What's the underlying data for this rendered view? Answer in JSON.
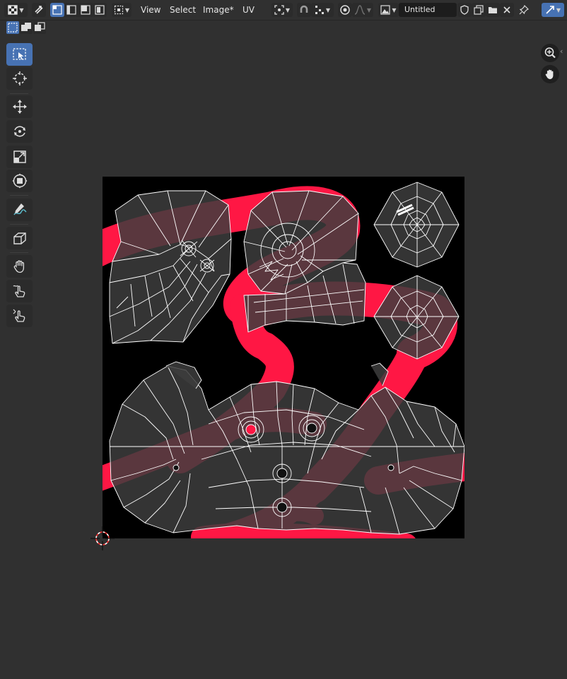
{
  "header": {
    "menus": [
      "View",
      "Select",
      "Image*",
      "UV"
    ],
    "image_name": "Untitled"
  },
  "icons": {
    "editor_type": "uv-editor-icon",
    "sync_selection": "sync-selection-icon",
    "select_modes": [
      "vertex-select-icon",
      "edge-select-icon",
      "face-select-icon",
      "island-select-icon"
    ],
    "sticky_mode": "sticky-select-icon",
    "pivot": "pivot-icon",
    "snap": "magnet-icon",
    "snap_target": "snap-increment-icon",
    "proportional": "proportional-edit-icon",
    "falloff": "falloff-curve-icon",
    "browse_image": "image-browse-icon",
    "fake_user": "shield-icon",
    "new_image": "new-image-icon",
    "open_image": "folder-icon",
    "unlink": "close-icon",
    "pin": "pin-icon",
    "gizmo": "gizmo-icon"
  },
  "tools": [
    {
      "name": "tool-select-box",
      "icon": "select-box-icon",
      "selected": true
    },
    {
      "name": "tool-cursor",
      "icon": "cursor-icon",
      "selected": false
    },
    {
      "name": "tool-move",
      "icon": "move-icon",
      "selected": false
    },
    {
      "name": "tool-rotate",
      "icon": "rotate-icon",
      "selected": false
    },
    {
      "name": "tool-scale",
      "icon": "scale-icon",
      "selected": false
    },
    {
      "name": "tool-transform",
      "icon": "transform-icon",
      "selected": false
    },
    {
      "name": "tool-annotate",
      "icon": "annotate-icon",
      "selected": false
    },
    {
      "name": "tool-rip-region",
      "icon": "rip-region-icon",
      "selected": false
    },
    {
      "name": "tool-grab",
      "icon": "grab-icon",
      "selected": false
    },
    {
      "name": "tool-relax",
      "icon": "relax-icon",
      "selected": false
    },
    {
      "name": "tool-pinch",
      "icon": "pinch-icon",
      "selected": false
    }
  ],
  "navigation": {
    "zoom": "zoom-icon",
    "pan": "hand-icon"
  },
  "colors": {
    "background": "#303030",
    "accent": "#4772b3",
    "texture_bg": "#000000",
    "stroke_red": "#ff1744",
    "face_fill": "#4a4a4a",
    "uv_edges": "#ffffff"
  }
}
